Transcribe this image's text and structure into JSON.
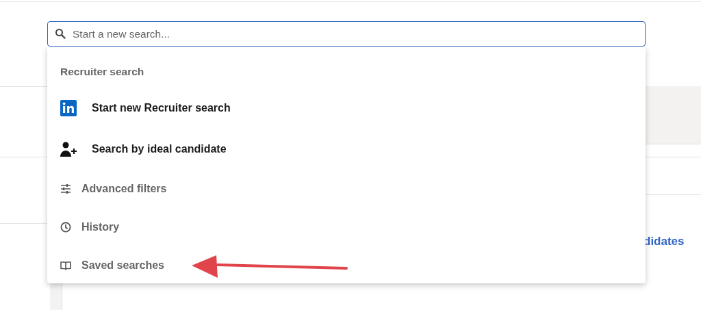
{
  "search": {
    "placeholder": "Start a new search..."
  },
  "menu": {
    "heading": "Recruiter search",
    "items": [
      {
        "kind": "linkedin",
        "label": "Start new Recruiter search",
        "primary": true
      },
      {
        "kind": "person-add",
        "label": "Search by ideal candidate",
        "primary": true
      },
      {
        "kind": "sliders",
        "label": "Advanced filters",
        "primary": false
      },
      {
        "kind": "clock",
        "label": "History",
        "primary": false
      },
      {
        "kind": "book",
        "label": "Saved searches",
        "primary": false
      }
    ]
  },
  "background_link": "didates"
}
